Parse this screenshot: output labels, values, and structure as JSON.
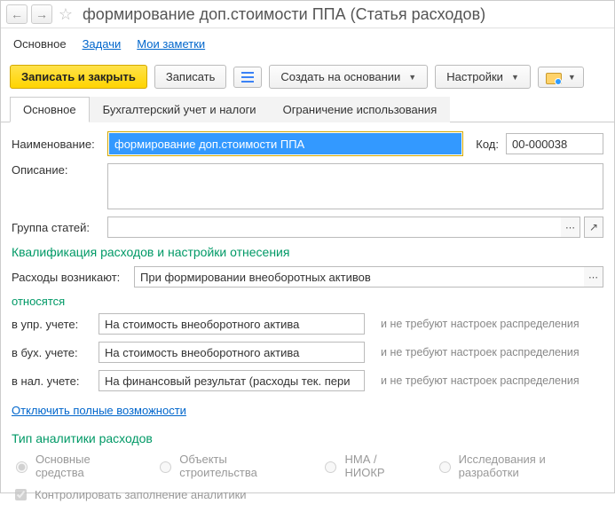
{
  "title": "формирование доп.стоимости ППА (Статья расходов)",
  "topnav": {
    "main": "Основное",
    "tasks": "Задачи",
    "notes": "Мои заметки"
  },
  "toolbar": {
    "save_close": "Записать и закрыть",
    "save": "Записать",
    "create_based": "Создать на основании",
    "settings": "Настройки"
  },
  "tabs": {
    "main": "Основное",
    "accounting": "Бухгалтерский учет и налоги",
    "restriction": "Ограничение использования"
  },
  "form": {
    "name_label": "Наименование:",
    "name_value": "формирование доп.стоимости ППА",
    "code_label": "Код:",
    "code_value": "00-000038",
    "desc_label": "Описание:",
    "desc_value": "",
    "group_label": "Группа статей:",
    "group_value": ""
  },
  "qual": {
    "title": "Квалификация расходов и настройки отнесения",
    "occur_label": "Расходы возникают:",
    "occur_value": "При формировании внеоборотных активов",
    "relate": "относятся",
    "rows": [
      {
        "label": "в упр. учете:",
        "value": "На стоимость внеоборотного актива",
        "hint": "и не требуют настроек распределения"
      },
      {
        "label": "в бух. учете:",
        "value": "На стоимость внеоборотного актива",
        "hint": "и не требуют настроек распределения"
      },
      {
        "label": "в нал. учете:",
        "value": "На финансовый результат (расходы тек. пери",
        "hint": "и не требуют настроек распределения"
      }
    ],
    "toggle_link": "Отключить полные возможности"
  },
  "analytics": {
    "title": "Тип аналитики расходов",
    "options": [
      "Основные средства",
      "Объекты строительства",
      "НМА / НИОКР",
      "Исследования и разработки"
    ],
    "checkbox": "Контролировать заполнение аналитики"
  }
}
